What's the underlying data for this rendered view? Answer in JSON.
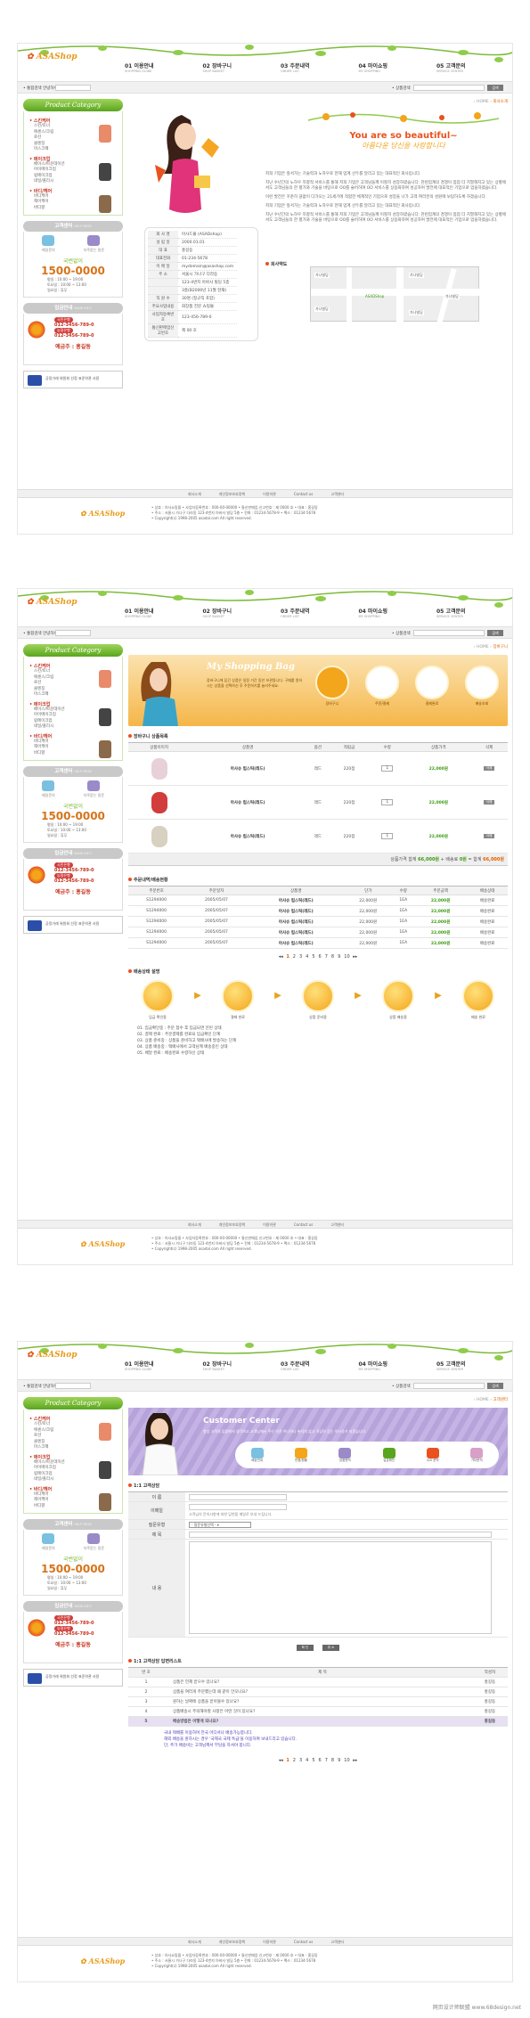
{
  "site": {
    "brand": "ASAShop",
    "nav": [
      {
        "num": "01",
        "ko": "이용안내",
        "en": "SHOPPING GUIDE"
      },
      {
        "num": "02",
        "ko": "장바구니",
        "en": "SHOP BASKET"
      },
      {
        "num": "03",
        "ko": "주문내역",
        "en": "ORDER LIST"
      },
      {
        "num": "04",
        "ko": "마이쇼핑",
        "en": "MY SHOPPING"
      },
      {
        "num": "05",
        "ko": "고객문의",
        "en": "SERVICE CENTER"
      }
    ],
    "toolbar_label": "• 통합검색 안녕하세요♡",
    "search_label": "• 상품검색",
    "search_button": "검색",
    "sidebar": {
      "category_title": "Product Category",
      "groups": [
        {
          "title": "스킨케어",
          "items": [
            "스킨/토너",
            "에센스/크림",
            "로션",
            "클렌징",
            "마스크팩"
          ]
        },
        {
          "title": "메이크업",
          "items": [
            "베이스/파운데이션",
            "아이메이크업",
            "립메이크업",
            "네일/폴리시"
          ]
        },
        {
          "title": "바디/헤어",
          "items": [
            "바디케어",
            "헤어케어",
            "바디향"
          ]
        }
      ],
      "cs_title": "고객센터",
      "cs_sub": "HELP DESK",
      "cs_icons": [
        "메일문의",
        "자주묻는 질문"
      ],
      "phone_label": "국번없이",
      "phone": "1500-0000",
      "hours": [
        "평일 : 10:00 ~ 19:00",
        "토요일 : 10:00 ~ 13:00",
        "일요일 : 휴무"
      ],
      "bank_title": "입금안내",
      "bank_sub": "BANK INFO",
      "banks": [
        {
          "name": "국민은행",
          "num": "012-3456-789-0"
        },
        {
          "name": "농협은행",
          "num": "012-3456-789-0"
        }
      ],
      "bank_holder": "예금주 : 홍길동",
      "fair_text": "공정거래 위원회 선정 표준약관 사용"
    },
    "footer_links": [
      "회사소개",
      "개인정보보호정책",
      "이용약관",
      "Contact us",
      "고객센터"
    ],
    "footer_info": [
      "• 상호 : 아사쇼핑몰 • 사업자등록번호 : 000-00-00000 • 통신판매업 신고번호 : 제 0000 호 • 대표 : 홍길동",
      "• 주소 : 서울시 가나구 다라동 123-4번지 아바사 빌딩 5층 • 전화 : 01234-5678-9 • 팩스 : 01234-5678",
      "• Copyright(c) 1998-2005 asadal.com All right reserved."
    ]
  },
  "page1": {
    "crumb_home": "HOME",
    "crumb_current": "회사소개",
    "banner_title": "You are so beautiful~",
    "banner_sub": "아름다운 당신을 사랑합니다",
    "intro_paragraphs": [
      "저희 기업은 앞서가는 기술력과 노하우로 한재 업계 선두를 달리고 있는 대표적인 회사입니다.",
      "지난 수년간의 노하우 지향적 서비스를 통해 저희 기업은 고객님들께 이철히 성장하였습니다. 관련업계의 경쟁이 점점 더 치열해지고 있는 상황에서도 고객님들의 한 평가와 기술을 바탕으로 OO를 슬어하여 OO 서비스를 상용화하여 성공하며 발전에 대표적인 기업으로 업을하였습니다.",
      "이런 발전은 꾸준히 끊없이 다가오는 21세기에 적합한 체계적인 기업으로 성장을 나가 고객 여러분의 성원에 보답하도록 하겠습니다.",
      "저희 기업은 앞서가는 기술력과 노하우로 한재 업계 선두를 달리고 있는 대표적인 회사입니다.",
      "지난 수년간의 노하우 지향적 서비스를 통해 저희 기업은 고객님들께 이철히 성장하였습니다. 관련업계의 경쟁이 점점 더 치열해지고 있는 상황에서도 고객님들의 한 평가와 기술을 바탕으로 OO를 슬어하여 OO 서비스를 상용화하여 성공하며 발전에 대표적인 기업으로 업을하였습니다."
    ],
    "map_title": "회사약도",
    "map_labels": [
      "가나빌딩",
      "가나빌딩",
      "ASADShop",
      "가나빌딩",
      "가나빌딩",
      "가나빌딩"
    ],
    "profile": [
      {
        "k": "회 사 명",
        "v": "아사드몰 (ASADshop)"
      },
      {
        "k": "설 립 일",
        "v": "2000.01.01"
      },
      {
        "k": "대 표",
        "v": "홍길동"
      },
      {
        "k": "대표전화",
        "v": "01-234-5678"
      },
      {
        "k": "이 메 일",
        "v": "mydomain@asashop.com"
      },
      {
        "k": "주 소",
        "v": "서울시 가나구 다라동"
      },
      {
        "k": "",
        "v": "123-4번지 아바사 빌딩 5층"
      },
      {
        "k": "",
        "v": "3층(B2000년 11월 현재)"
      },
      {
        "k": "직 원 수",
        "v": "30명 (정규직 포함)"
      },
      {
        "k": "주요사업내용",
        "v": "화장품 전문 쇼핑몰"
      },
      {
        "k": "사업자등록번호",
        "v": "123-456-789-0"
      },
      {
        "k": "통신판매업신고번호",
        "v": "제 00 호"
      }
    ]
  },
  "page2": {
    "crumb_home": "HOME",
    "crumb_current": "장바구니",
    "banner_title": "My Shopping Bag",
    "banner_text": "장바구니에 담긴 상품은 일정 기간 동안 보관됩니다. 구매를 원하시는 상품을 선택하신 후 주문하기를 눌러주세요.",
    "banner_steps": [
      "장바구니",
      "주문/결제",
      "결제완료",
      "배송조회"
    ],
    "cart_title": "장바구니 상품목록",
    "cart_headers": [
      "상품이미지",
      "상품명",
      "옵션",
      "적립금",
      "수량",
      "상품가격",
      "삭제"
    ],
    "cart_rows": [
      {
        "name": "아사슈 립스틱(레드)",
        "opt": "레드",
        "point": "220점",
        "qty": "1",
        "price": "22,000원",
        "del": "삭제"
      },
      {
        "name": "아사슈 립스틱(레드)",
        "opt": "레드",
        "point": "220점",
        "qty": "1",
        "price": "22,000원",
        "del": "삭제"
      },
      {
        "name": "아사슈 립스틱(레드)",
        "opt": "레드",
        "point": "220점",
        "qty": "1",
        "price": "22,000원",
        "del": "삭제"
      }
    ],
    "total_label": "상품가격 합계",
    "total_value": "66,000원",
    "ship_label": "배송료",
    "ship_value": "0원",
    "grand_label": "합계",
    "grand_value": "66,000원",
    "order_title": "주문내역/배송현황",
    "order_headers": [
      "주문번호",
      "주문일자",
      "상품명",
      "단가",
      "수량",
      "주문금액",
      "배송상태"
    ],
    "order_rows": [
      [
        "S1294000",
        "2005/05/07",
        "아사슈 립스틱(레드)",
        "22,000원",
        "1EA",
        "22,000원",
        "배송완료"
      ],
      [
        "S1294000",
        "2005/05/07",
        "아사슈 립스틱(레드)",
        "22,000원",
        "1EA",
        "22,000원",
        "배송완료"
      ],
      [
        "S1294000",
        "2005/05/07",
        "아사슈 립스틱(레드)",
        "22,000원",
        "1EA",
        "22,000원",
        "배송완료"
      ],
      [
        "S1294000",
        "2005/05/07",
        "아사슈 립스틱(레드)",
        "22,000원",
        "1EA",
        "22,000원",
        "배송완료"
      ],
      [
        "S1294000",
        "2005/05/07",
        "아사슈 립스틱(레드)",
        "22,000원",
        "1EA",
        "22,000원",
        "배송완료"
      ]
    ],
    "pages": [
      "1",
      "2",
      "3",
      "4",
      "5",
      "6",
      "7",
      "8",
      "9",
      "10"
    ],
    "process_title": "배송상태 설명",
    "process_steps": [
      "입금 확인중",
      "결제 완료",
      "상품 준비중",
      "상품 배송중",
      "배송 완료"
    ],
    "process_notes": [
      "01. 입금확인중 : 주문 접수 후 입금되면 안된 상태",
      "02. 결제 완료 : 주문결제를 완료되 입금확인 단계",
      "03. 상품 준비중 : 상품을 준비하고 택배사에 발송하는 단계",
      "04. 상품 배송중 : 택배사에서 고객님께 배송중인 상태",
      "05. 배달 완료 : 배송완료 수령하신 상태"
    ]
  },
  "page3": {
    "crumb_home": "HOME",
    "crumb_current": "고객센터",
    "banner_title": "Customer Center",
    "banner_text": "항상 고객의 입장에서 생각하고 고객님께서 주신 의견 하나하나 놓치지 않고 귀담아 듣는 아사슈가 되겠습니다.",
    "banner_icons": [
      "배송안내",
      "반품/환불",
      "상품문의",
      "입금확인",
      "A/S 문의",
      "기타문의"
    ],
    "form_title": "1:1 고객상담",
    "form_labels": [
      "이 름",
      "이메일",
      "질문유형",
      "제 목",
      "내 용"
    ],
    "email_note": "고객님의 문의사항에 대한 답변을 메일로 보내 드립니다.",
    "select_value": "- 질문유형선택 -",
    "btn_ok": "확 인",
    "btn_cancel": "취 소",
    "list_title": "1:1 고객상담 답변리스트",
    "list_headers": [
      "번 호",
      "제 목",
      "작성자"
    ],
    "list_rows": [
      {
        "n": "1",
        "t": "상품은 언제 받으수 있나요?",
        "w": "홍길동"
      },
      {
        "n": "2",
        "t": "상품을 여러개 주문했는데 왜 같이 안오나요?",
        "w": "홍길동"
      },
      {
        "n": "3",
        "t": "원하는 날짜에 상품을 받아볼수 있나요?",
        "w": "홍길동"
      },
      {
        "n": "4",
        "t": "상품배송시 주의해야할 사항은 어떤 것이 있나요?",
        "w": "홍길동"
      },
      {
        "n": "5",
        "t": "배송방법은 어떻게 되나요?",
        "w": "홍길동"
      }
    ],
    "answer_lines": [
      "국내 택배를 이용하며 전국 어디서나 배송가능합니다.",
      "해외 배송을 원하시는 경우 '국제국 국제 특급'을 이용하여 보내드리고 있습니다.",
      "단, 추가 배송비는 고객님께서 부담을 하셔야 합니다."
    ],
    "pages": [
      "1",
      "2",
      "3",
      "4",
      "5",
      "6",
      "7",
      "8",
      "9",
      "10"
    ]
  },
  "watermark": "网页设计师联盟 www.68design.net",
  "colors": {
    "accent": "#e9521e",
    "green": "#5aa51e",
    "orange": "#f3a51b",
    "purple": "#b6a3d9"
  }
}
